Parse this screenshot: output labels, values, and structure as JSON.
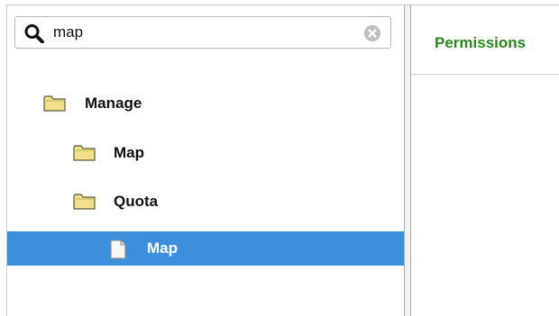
{
  "search": {
    "value": "map",
    "placeholder": ""
  },
  "tree": {
    "items": [
      {
        "label": "Manage",
        "icon": "folder-icon",
        "level": 0,
        "selected": false
      },
      {
        "label": "Map",
        "icon": "folder-icon",
        "level": 1,
        "selected": false
      },
      {
        "label": "Quota",
        "icon": "folder-icon",
        "level": 1,
        "selected": false
      },
      {
        "label": "Map",
        "icon": "document-icon",
        "level": 2,
        "selected": true
      }
    ]
  },
  "right_panel": {
    "tabs": [
      {
        "label": "Permissions"
      }
    ]
  },
  "colors": {
    "selection": "#3b8fdd",
    "tab_text": "#2b8a1f",
    "folder_fill": "#f3e08a"
  }
}
